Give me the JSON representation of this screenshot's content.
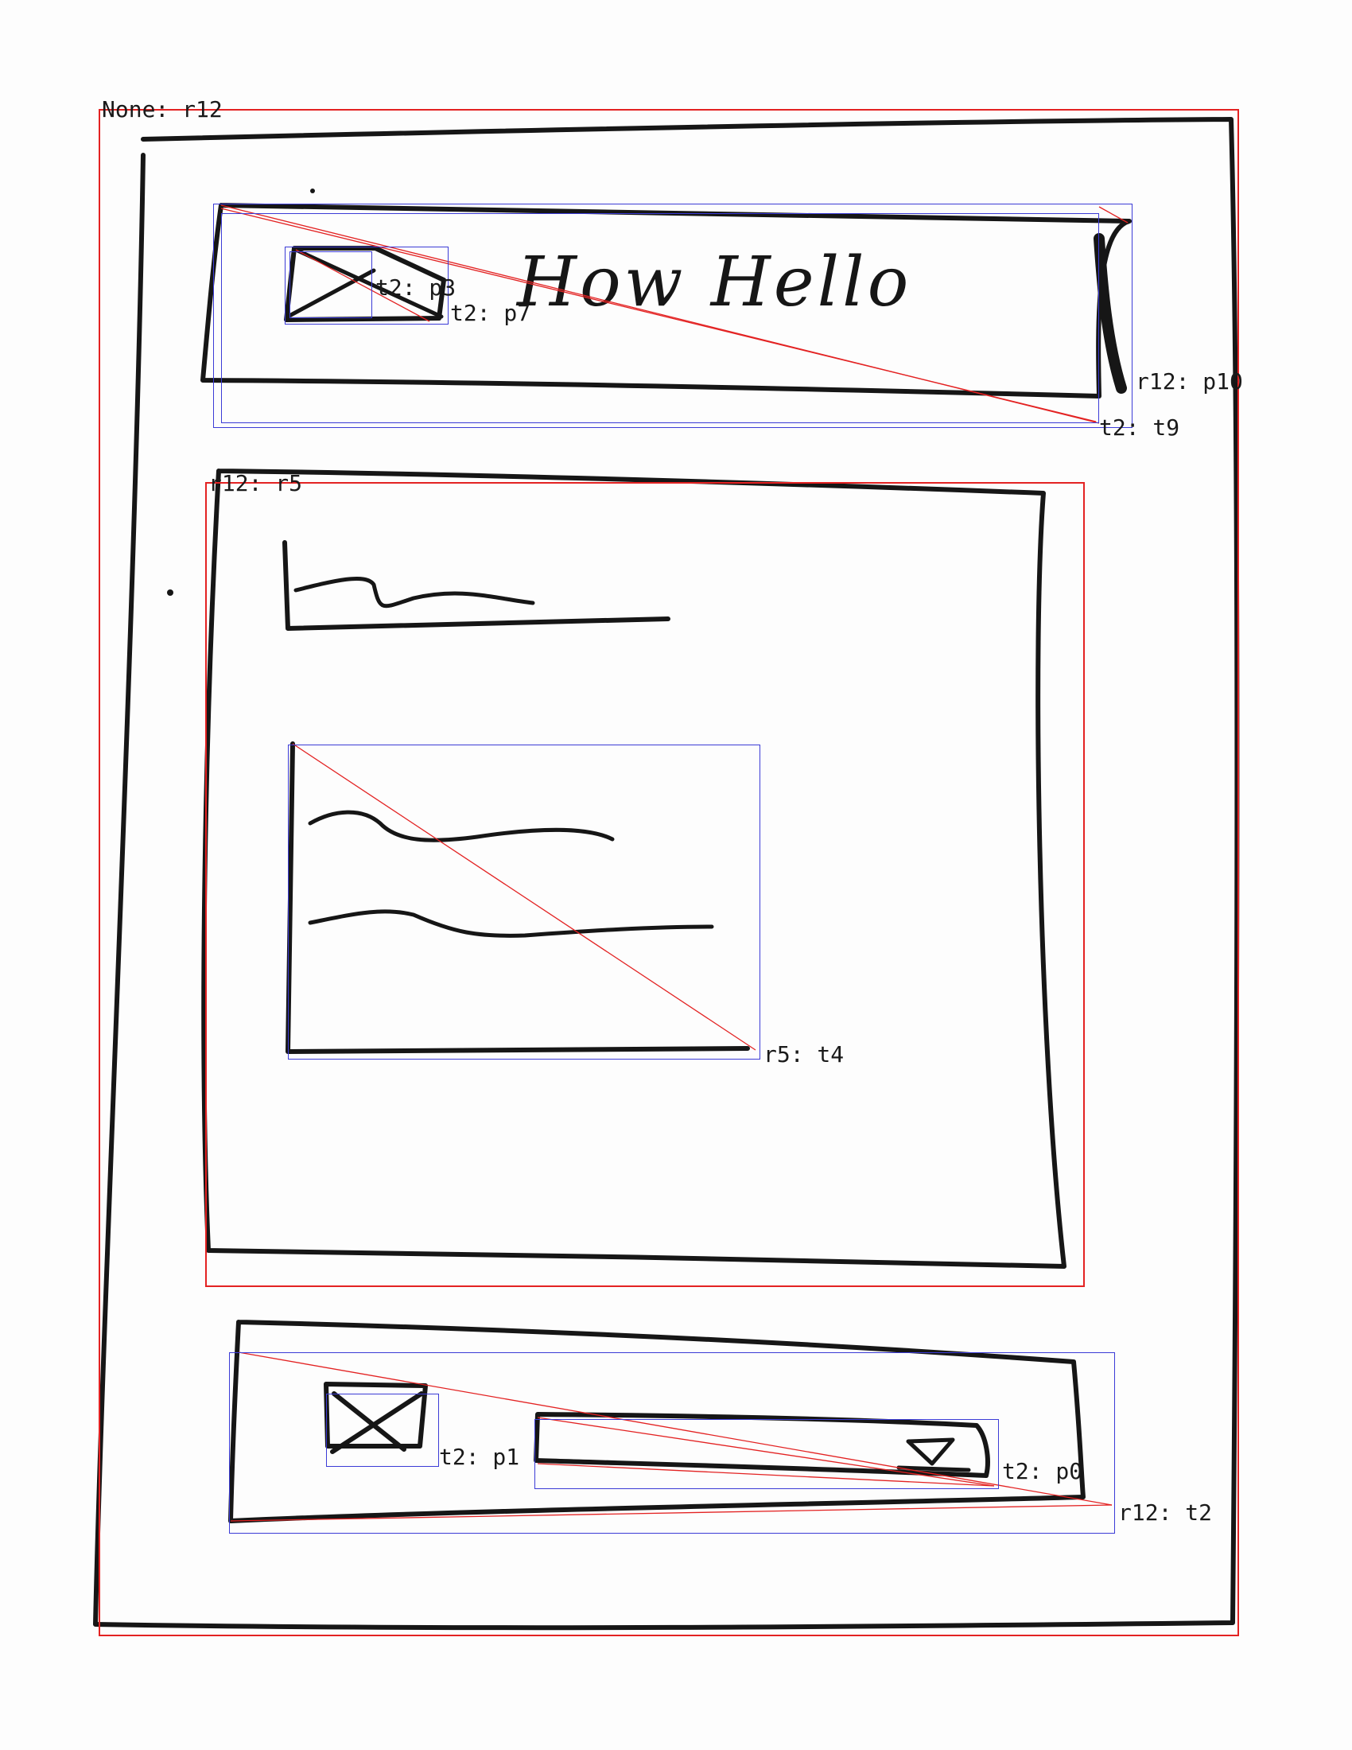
{
  "header": {
    "title_text": "How Hello"
  },
  "annotations": {
    "root": "None: r12",
    "header_container": "r12: p10",
    "header_bar": "t2: t9",
    "header_icon_outer": "t2: p7",
    "header_icon_inner": "t2: p3",
    "content_panel": "r12: r5",
    "content_card": "r5: t4",
    "footer_bar": "r12: t2",
    "footer_icon": "t2: p1",
    "footer_dropdown": "t2: p0"
  },
  "colors": {
    "annotation_container": "#e32222",
    "annotation_element": "#3b3bd6",
    "sketch_ink": "#161616"
  }
}
